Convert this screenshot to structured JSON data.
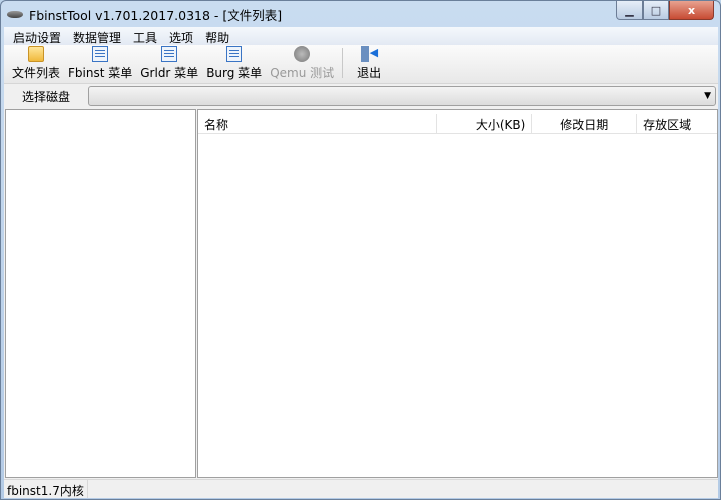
{
  "window": {
    "title": "FbinstTool v1.701.2017.0318 - [文件列表]",
    "close_glyph": "x"
  },
  "menu": [
    "启动设置",
    "数据管理",
    "工具",
    "选项",
    "帮助"
  ],
  "toolbar": [
    {
      "label": "文件列表",
      "icon": "folder-icon"
    },
    {
      "label": "Fbinst 菜单",
      "icon": "menu-doc-icon"
    },
    {
      "label": "Grldr 菜单",
      "icon": "menu-doc-icon"
    },
    {
      "label": "Burg 菜单",
      "icon": "menu-doc-icon"
    },
    {
      "label": "Qemu 测试",
      "icon": "gear-icon",
      "disabled": true
    },
    {
      "label": "退出",
      "icon": "exit-icon"
    }
  ],
  "disk": {
    "label": "选择磁盘",
    "value": ""
  },
  "columns": [
    "名称",
    "大小(KB)",
    "修改日期",
    "存放区域"
  ],
  "status": {
    "text": "fbinst1.7内核"
  }
}
